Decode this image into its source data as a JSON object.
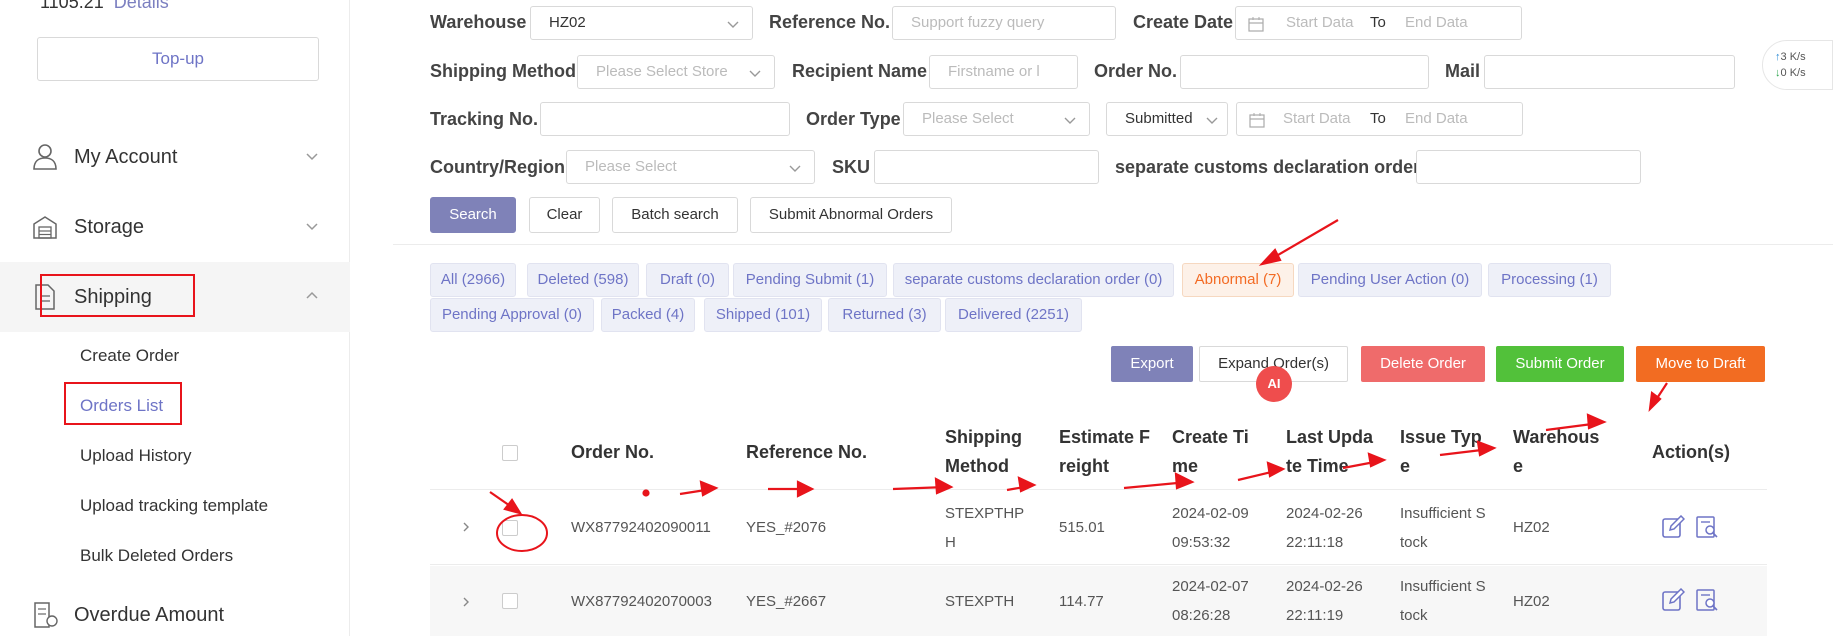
{
  "sidebar": {
    "balance": "1105.21",
    "details_link": "Details",
    "topup_label": "Top-up",
    "menu": [
      {
        "label": "My Account",
        "icon": "user-icon"
      },
      {
        "label": "Storage",
        "icon": "warehouse-icon"
      },
      {
        "label": "Shipping",
        "icon": "document-icon"
      }
    ],
    "submenu": [
      "Create Order",
      "Orders List",
      "Upload History",
      "Upload tracking template",
      "Bulk Deleted Orders"
    ],
    "overdue_label": "Overdue Amount"
  },
  "filters": {
    "warehouse_label": "Warehouse",
    "warehouse_value": "HZ02",
    "reference_label": "Reference No.",
    "reference_placeholder": "Support fuzzy query",
    "create_date_label": "Create Date",
    "start_placeholder": "Start Data",
    "to": "To",
    "end_placeholder": "End Data",
    "shipping_method_label": "Shipping Method",
    "shipping_method_placeholder": "Please Select Store",
    "recipient_label": "Recipient Name",
    "recipient_placeholder": "Firstname or l",
    "order_no_label": "Order No.",
    "mail_label": "Mail",
    "tracking_label": "Tracking No.",
    "order_type_label": "Order Type",
    "order_type_placeholder": "Please Select",
    "submitted_value": "Submitted",
    "country_label": "Country/Region",
    "country_placeholder": "Please Select",
    "sku_label": "SKU",
    "customs_label": "separate customs declaration order"
  },
  "buttons": {
    "search": "Search",
    "clear": "Clear",
    "batch_search": "Batch search",
    "submit_abnormal": "Submit Abnormal Orders"
  },
  "tabs_row1": [
    "All (2966)",
    "Deleted (598)",
    "Draft (0)",
    "Pending Submit (1)",
    "separate customs declaration order (0)",
    "Abnormal (7)",
    "Pending User Action (0)",
    "Processing (1)"
  ],
  "tabs_row2": [
    "Pending Approval (0)",
    "Packed (4)",
    "Shipped (101)",
    "Returned (3)",
    "Delivered (2251)"
  ],
  "actions": {
    "export": "Export",
    "expand": "Expand Order(s)",
    "delete": "Delete Order",
    "submit": "Submit Order",
    "move_draft": "Move to Draft",
    "colors": {
      "export": "#7f82b8",
      "delete": "#ef6b6b",
      "submit": "#52c13a",
      "move_draft": "#f26c22"
    }
  },
  "ai_badge": "AI",
  "table": {
    "headers": {
      "order_no": "Order No.",
      "reference_no": "Reference No.",
      "shipping_method_1": "Shipping",
      "shipping_method_2": "Method",
      "freight_1": "Estimate F",
      "freight_2": "reight",
      "create_1": "Create Ti",
      "create_2": "me",
      "update_1": "Last Upda",
      "update_2": "te Time",
      "issue_1": "Issue Typ",
      "issue_2": "e",
      "warehouse_1": "Warehous",
      "warehouse_2": "e",
      "actions": "Action(s)"
    },
    "rows": [
      {
        "order_no": "WX87792402090011",
        "reference_no": "YES_#2076",
        "shipping_1": "STEXPTHP",
        "shipping_2": "H",
        "freight": "515.01",
        "create_1": "2024-02-09",
        "create_2": "09:53:32",
        "update_1": "2024-02-26",
        "update_2": "22:11:18",
        "issue_1": "Insufficient S",
        "issue_2": "tock",
        "warehouse": "HZ02"
      },
      {
        "order_no": "WX87792402070003",
        "reference_no": "YES_#2667",
        "shipping_1": "STEXPTH",
        "shipping_2": "",
        "freight": "114.77",
        "create_1": "2024-02-07",
        "create_2": "08:26:28",
        "update_1": "2024-02-26",
        "update_2": "22:11:19",
        "issue_1": "Insufficient S",
        "issue_2": "tock",
        "warehouse": "HZ02"
      }
    ]
  },
  "speed": {
    "up": "3",
    "down": "0",
    "unit": "K/s"
  }
}
